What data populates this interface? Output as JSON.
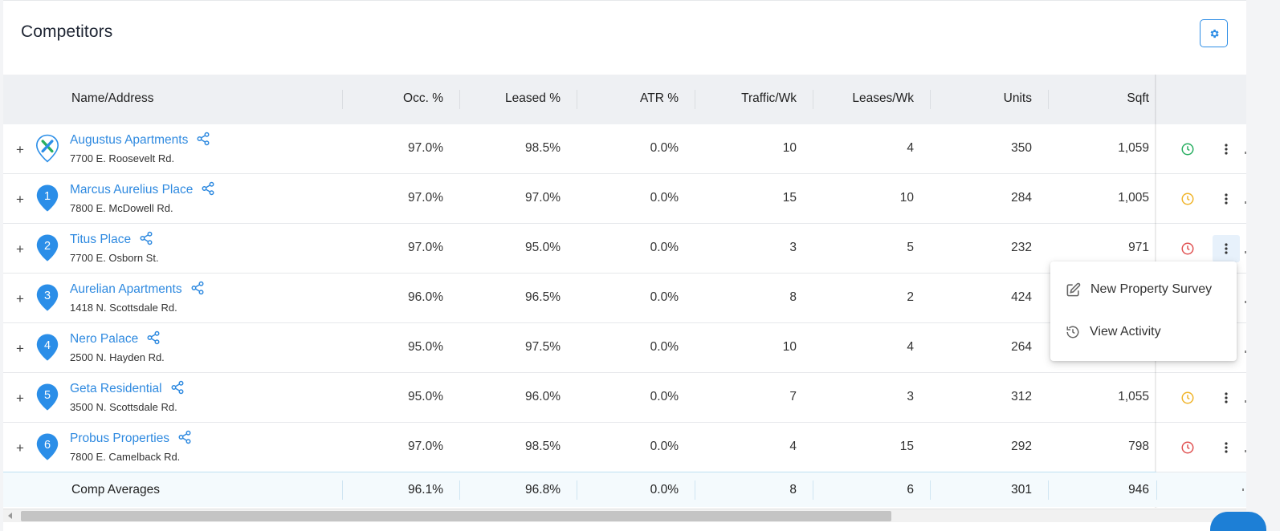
{
  "header": {
    "title": "Competitors"
  },
  "columns": {
    "name": "Name/Address",
    "occ": "Occ. %",
    "leased": "Leased %",
    "atr": "ATR %",
    "traffic": "Traffic/Wk",
    "leases": "Leases/Wk",
    "units": "Units",
    "sqft": "Sqft"
  },
  "rows": [
    {
      "pin": "X",
      "name": "Augustus Apartments",
      "address": "7700 E. Roosevelt Rd.",
      "occ": "97.0%",
      "leased": "98.5%",
      "atr": "0.0%",
      "traffic": "10",
      "leases": "4",
      "units": "350",
      "sqft": "1,059",
      "status": "green"
    },
    {
      "pin": "1",
      "name": "Marcus Aurelius Place",
      "address": "7800 E. McDowell Rd.",
      "occ": "97.0%",
      "leased": "97.0%",
      "atr": "0.0%",
      "traffic": "15",
      "leases": "10",
      "units": "284",
      "sqft": "1,005",
      "status": "yellow"
    },
    {
      "pin": "2",
      "name": "Titus Place",
      "address": "7700 E. Osborn St.",
      "occ": "97.0%",
      "leased": "95.0%",
      "atr": "0.0%",
      "traffic": "3",
      "leases": "5",
      "units": "232",
      "sqft": "971",
      "status": "red"
    },
    {
      "pin": "3",
      "name": "Aurelian Apartments",
      "address": "1418 N. Scottsdale Rd.",
      "occ": "96.0%",
      "leased": "96.5%",
      "atr": "0.0%",
      "traffic": "8",
      "leases": "2",
      "units": "424",
      "sqft": "",
      "status": ""
    },
    {
      "pin": "4",
      "name": "Nero Palace",
      "address": "2500 N. Hayden Rd.",
      "occ": "95.0%",
      "leased": "97.5%",
      "atr": "0.0%",
      "traffic": "10",
      "leases": "4",
      "units": "264",
      "sqft": "",
      "status": ""
    },
    {
      "pin": "5",
      "name": "Geta Residential",
      "address": "3500 N. Scottsdale Rd.",
      "occ": "95.0%",
      "leased": "96.0%",
      "atr": "0.0%",
      "traffic": "7",
      "leases": "3",
      "units": "312",
      "sqft": "1,055",
      "status": "yellow"
    },
    {
      "pin": "6",
      "name": "Probus Properties",
      "address": "7800 E. Camelback Rd.",
      "occ": "97.0%",
      "leased": "98.5%",
      "atr": "0.0%",
      "traffic": "4",
      "leases": "15",
      "units": "292",
      "sqft": "798",
      "status": "red"
    }
  ],
  "averages": {
    "label": "Comp Averages",
    "occ": "96.1%",
    "leased": "96.8%",
    "atr": "0.0%",
    "traffic": "8",
    "leases": "6",
    "units": "301",
    "sqft": "946"
  },
  "context_menu": {
    "items": [
      {
        "label": "New Property Survey",
        "icon": "edit-icon"
      },
      {
        "label": "View Activity",
        "icon": "history-icon"
      }
    ]
  },
  "colors": {
    "link": "#2f8ae0",
    "pin": "#2b8ee8",
    "status_green": "#27ae60",
    "status_yellow": "#f0b429",
    "status_red": "#e05252"
  }
}
